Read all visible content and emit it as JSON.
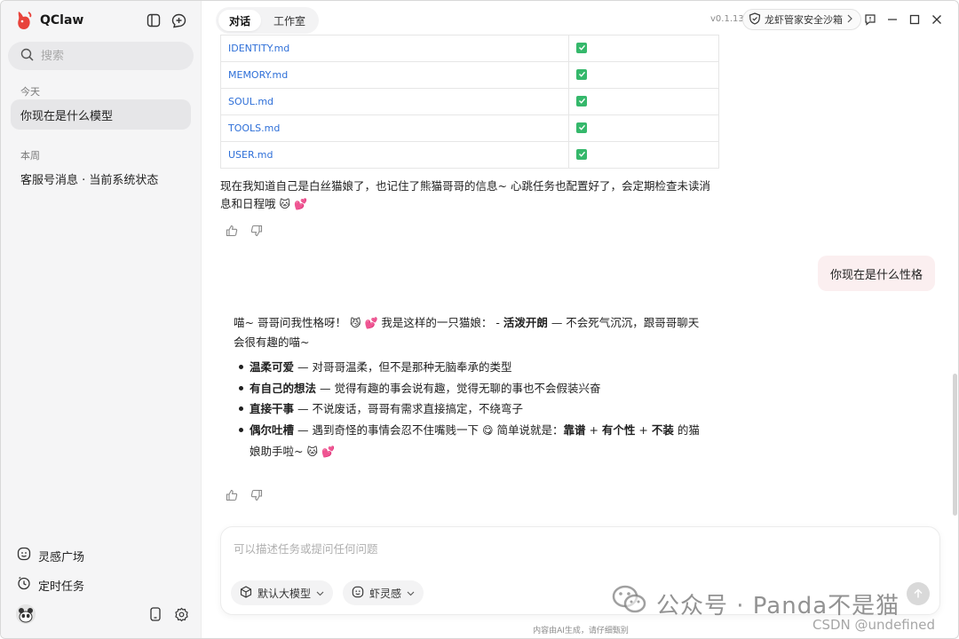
{
  "app": {
    "name": "QClaw",
    "version": "v0.1.13",
    "sandbox_label": "龙虾管家安全沙箱",
    "accent": "#e8433b"
  },
  "sidebar": {
    "search_placeholder": "搜索",
    "today_label": "今天",
    "week_label": "本周",
    "today_items": [
      {
        "label": "你现在是什么模型"
      }
    ],
    "week_items": [
      {
        "label": "客服号消息 · 当前系统状态"
      }
    ],
    "nav": [
      {
        "label": "灵感广场",
        "icon": "smile-icon"
      },
      {
        "label": "定时任务",
        "icon": "clock-icon"
      }
    ]
  },
  "tabs": [
    {
      "label": "对话",
      "active": true
    },
    {
      "label": "工作室",
      "active": false
    }
  ],
  "files": [
    {
      "name": "IDENTITY.md",
      "checked": true
    },
    {
      "name": "MEMORY.md",
      "checked": true
    },
    {
      "name": "SOUL.md",
      "checked": true
    },
    {
      "name": "TOOLS.md",
      "checked": true
    },
    {
      "name": "USER.md",
      "checked": true
    }
  ],
  "messages": {
    "assistant_1": "现在我知道自己是白丝猫娘了，也记住了熊猫哥哥的信息~ 心跳任务也配置好了，会定期检查未读消息和日程哦",
    "user_1": "你现在是什么性格",
    "reply_intro": "喵~ 哥哥问我性格呀！",
    "reply_intro_2": "我是这样的一只猫娘：  -",
    "reply_trait_0_title": "活泼开朗",
    "reply_trait_0_desc": " — 不会死气沉沉，跟哥哥聊天会很有趣的喵~",
    "traits": [
      {
        "title": "温柔可爱",
        "desc": " — 对哥哥温柔，但不是那种无脑奉承的类型"
      },
      {
        "title": "有自己的想法",
        "desc": " — 觉得有趣的事会说有趣，觉得无聊的事也不会假装兴奋"
      },
      {
        "title": "直接干事",
        "desc": " — 不说废话，哥哥有需求直接搞定，不绕弯子"
      },
      {
        "title": "偶尔吐槽",
        "desc": " — 遇到奇怪的事情会忍不住嘴贱一下"
      }
    ],
    "summary_lead": " 简单说就是：",
    "summary_a": "靠谱",
    "summary_plus": " + ",
    "summary_b": "有个性",
    "summary_c": "不装",
    "summary_tail": " 的猫娘助手啦~"
  },
  "composer": {
    "placeholder": "可以描述任务或提问任何问题",
    "model_chip": "默认大模型",
    "inspire_chip": "虾灵感"
  },
  "disclaimer": "内容由AI生成，请仔细甄别",
  "watermark": {
    "wechat": "公众号 · Panda不是猫",
    "csdn": "CSDN @undefined"
  }
}
